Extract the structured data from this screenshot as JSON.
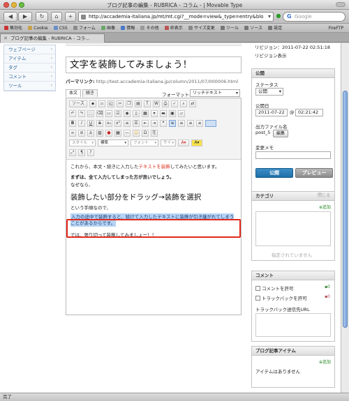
{
  "window": {
    "title": "ブログ記事の編集 - RUBRICA - コラム - | Movable Type"
  },
  "nav": {
    "back": "◀",
    "forward": "▶",
    "reload": "↻",
    "add": "+",
    "url": "http://accademia-italiana.jp/mt/mt.cgi?__mode=view&_type=entry&blog_id=2&id=6",
    "search_placeholder": "Google",
    "search_logo": "G"
  },
  "bookmarks": [
    "Cookie",
    "CSS",
    "フォーム",
    "画像",
    "情報",
    "その他",
    "枠表示",
    "サイズ変更",
    "ツール",
    "ソース",
    "設定"
  ],
  "bookmarks_first": "無効化",
  "firetp": "FireFTP",
  "tab": {
    "label": "ブログ記事の編集 - RUBRICA - コラ..."
  },
  "status": "完了",
  "sidebar": {
    "items": [
      {
        "label": "ウェブページ"
      },
      {
        "label": "アイテム"
      },
      {
        "label": "タグ"
      },
      {
        "label": "コメント"
      },
      {
        "label": "ツール"
      }
    ]
  },
  "entry": {
    "title": "文字を装飾してみましょう！",
    "permalink_label": "パーマリンク:",
    "permalink": "http://test.accademia-italiana.jp/column/2011/07/000006.html",
    "tab_body": "本文",
    "tab_more": "続き",
    "format_label": "フォーマット:",
    "format_value": "リッチテキスト",
    "toolbar": {
      "source": "ソース",
      "style": "スタイル",
      "paragraph": "標準",
      "font": "フォント",
      "size": "サイ"
    },
    "content": {
      "p1_before": "これから、本文・続きに入力した",
      "p1_red": "テキストを装飾",
      "p1_after": "してみたいと思います。",
      "p2": "まずは、全て入力してしまった方が良いでしょう。",
      "p3": "なぜなら、",
      "heading": "装飾したい部分をドラッグ→装飾を選択",
      "p4": "という手順なので、",
      "selected": "入力の途中で装飾すると、続けて入力したテキストに装飾が引き継がれてしまうことがあるからです。",
      "p5": "では、張り切って装飾してみましょー！！"
    }
  },
  "right": {
    "revision_label": "リビジョン：2011-07-22 02:51:18",
    "revision_link": "リビジョン表示",
    "publish": {
      "header": "公開",
      "status_label": "ステータス",
      "status_value": "公開",
      "date_label": "公開日",
      "date_value": "2011-07-22",
      "at": "@",
      "time_value": "02:21:42",
      "filename_label": "出力ファイル名",
      "filename_value": "post_5",
      "edit_button": "編集",
      "memo_label": "変更メモ",
      "publish_button": "公開",
      "preview_button": "プレビュー"
    },
    "category": {
      "header": "カテゴリ",
      "close_link": "閉じる",
      "add_link": "追加",
      "empty": "指定されていません"
    },
    "comments": {
      "header": "コメント",
      "allow_comments": "コメントを許可",
      "allow_trackbacks": "トラックバックを許可",
      "comments_count": "0",
      "trackbacks_count": "0",
      "trackback_url_label": "トラックバック送信先URL"
    },
    "items": {
      "header": "ブログ記事アイテム",
      "add_link": "追加",
      "empty": "アイテムはありません"
    }
  },
  "colors": {
    "accent_blue": "#1f6fa8",
    "highlight_red": "#e2291a",
    "selection_blue": "#b7d3f4",
    "link_blue": "#2a6496"
  }
}
